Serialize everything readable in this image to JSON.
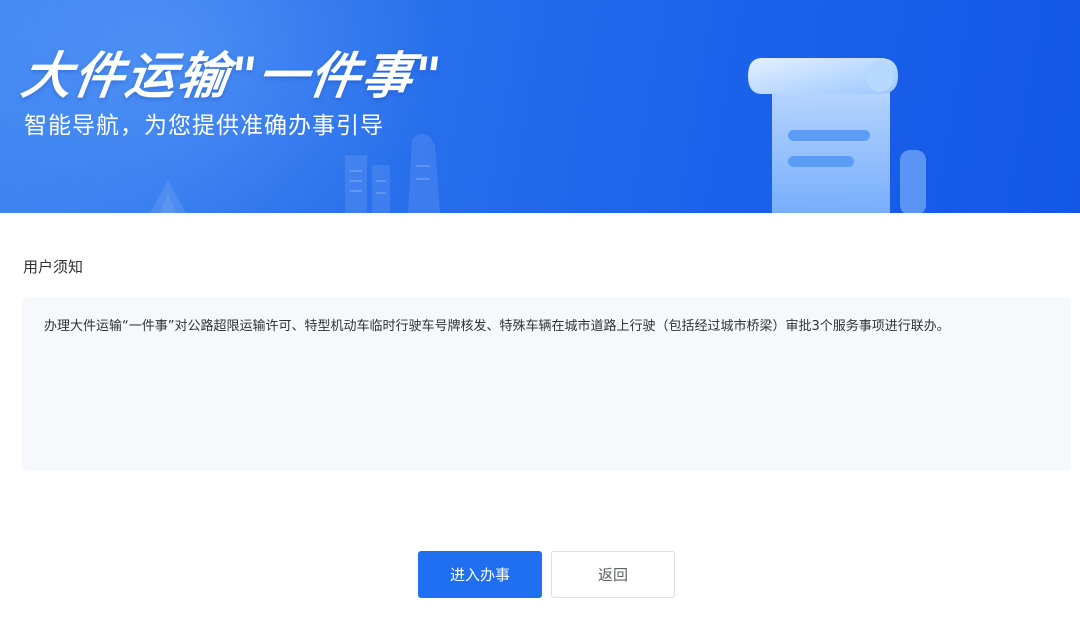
{
  "banner": {
    "title": "大件运输\"一件事\"",
    "subtitle": "智能导航，为您提供准确办事引导"
  },
  "notice": {
    "heading": "用户须知",
    "content": "办理大件运输“一件事”对公路超限运输许可、特型机动车临时行驶车号牌核发、特殊车辆在城市道路上行驶（包括经过城市桥梁）审批3个服务事项进行联办。"
  },
  "actions": {
    "enter_label": "进入办事",
    "back_label": "返回"
  },
  "colors": {
    "primary": "#1f6ff0",
    "banner_start": "#3d84f1",
    "banner_end": "#1457e6"
  },
  "icons": [
    "document-scroll-icon",
    "city-skyline-illustration"
  ]
}
